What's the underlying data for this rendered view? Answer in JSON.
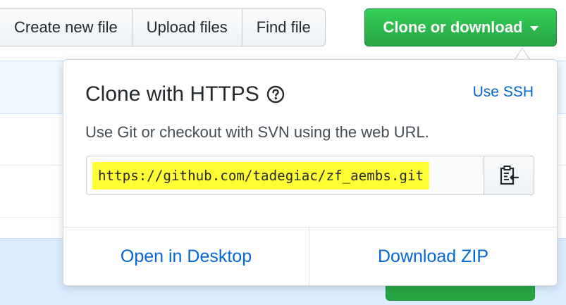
{
  "toolbar": {
    "create_new_file": "Create new file",
    "upload_files": "Upload files",
    "find_file": "Find file",
    "clone_or_download": "Clone or download"
  },
  "clone_popover": {
    "title": "Clone with HTTPS",
    "help_icon": "question-circle-icon",
    "use_ssh": "Use SSH",
    "description": "Use Git or checkout with SVN using the web URL.",
    "clone_url": "https://github.com/tadegiac/zf_aembs.git",
    "copy_icon": "clipboard-icon",
    "open_in_desktop": "Open in Desktop",
    "download_zip": "Download ZIP"
  },
  "colors": {
    "primary_green": "#28a745",
    "link_blue": "#0366d6",
    "url_highlight": "#ffff33"
  }
}
